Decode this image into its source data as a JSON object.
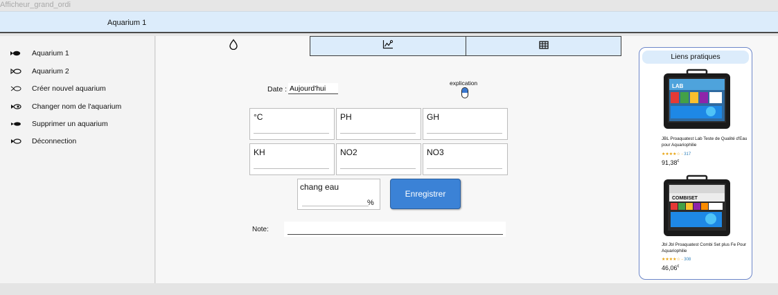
{
  "frame": {
    "title": "Afficheur_grand_ordi"
  },
  "header": {
    "title": "Aquarium 1"
  },
  "sidebar": {
    "items": [
      {
        "label": "Aquarium 1",
        "icon": "fish-filled-icon"
      },
      {
        "label": "Aquarium 2",
        "icon": "fish-outline-icon"
      },
      {
        "label": "Créer nouvel aquarium",
        "icon": "fish-outline-icon"
      },
      {
        "label": "Changer nom de l'aquarium",
        "icon": "fish-eye-icon"
      },
      {
        "label": "Supprimer un aquarium",
        "icon": "fish-filled-icon"
      },
      {
        "label": "Déconnection",
        "icon": "fish-outline-icon"
      }
    ]
  },
  "tabs": [
    {
      "name": "water-drop-icon",
      "active": true
    },
    {
      "name": "line-chart-icon",
      "active": false
    },
    {
      "name": "table-icon",
      "active": false
    }
  ],
  "form": {
    "date_label": "Date :",
    "date_value": "Aujourd'hui",
    "explication_label": "explication",
    "fields": [
      {
        "label": "°C"
      },
      {
        "label": "PH"
      },
      {
        "label": "GH"
      },
      {
        "label": "KH"
      },
      {
        "label": "NO2"
      },
      {
        "label": "NO3"
      }
    ],
    "chang_label": "chang eau",
    "chang_unit": "%",
    "save_label": "Enregistrer",
    "note_label": "Note:"
  },
  "links": {
    "title": "Liens pratiques",
    "products": [
      {
        "title": "JBL Proaquatest Lab Teste de Qualité d'Eau pour Aquariophilie",
        "stars": "★★★★☆",
        "reviews": "317",
        "price_main": "91,38",
        "price_sup": "€",
        "box_label": "LAB"
      },
      {
        "title": "Jbl Jbl Proaquatest Combi Set plus Fe Pour Aquariophilie",
        "stars": "★★★★☆",
        "reviews": "308",
        "price_main": "46,06",
        "price_sup": "€",
        "box_label": "COMBISET"
      }
    ]
  },
  "colors": {
    "accent": "#3b82d6",
    "header_bg": "#dcecfb",
    "links_border": "#6c86c9"
  }
}
